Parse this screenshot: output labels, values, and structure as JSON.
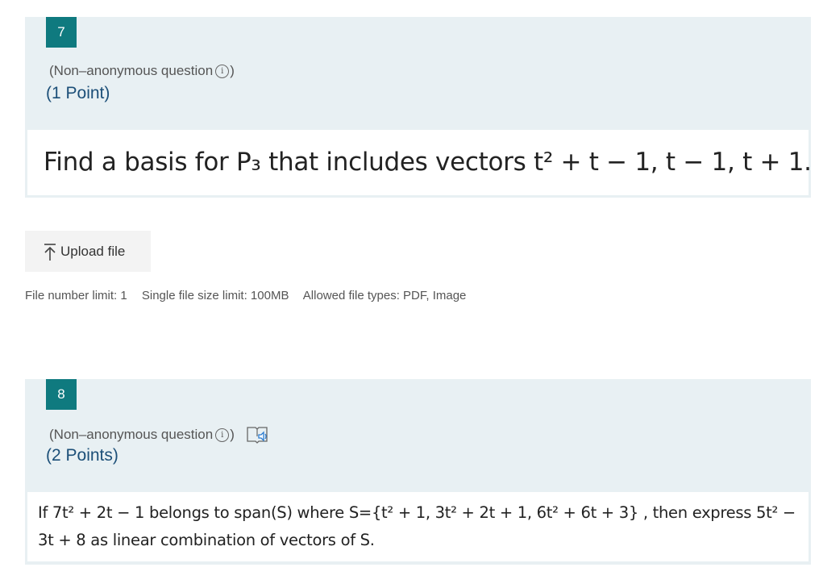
{
  "questions": [
    {
      "number": "7",
      "meta_label": "(Non–anonymous question",
      "meta_close": ")",
      "info_glyph": "i",
      "points": "(1 Point)",
      "body": "Find a basis for P₃ that includes vectors t² + t − 1, t − 1, t + 1."
    },
    {
      "number": "8",
      "meta_label": "(Non–anonymous question",
      "meta_close": ")",
      "info_glyph": "i",
      "points": "(2 Points)",
      "body": "If 7t² + 2t − 1 belongs to span(S) where S={t² + 1, 3t² + 2t + 1, 6t² + 6t + 3} , then express 5t² − 3t + 8 as linear combination of vectors of S."
    }
  ],
  "upload": {
    "label": "Upload file",
    "icon": "upload-arrow-icon"
  },
  "file_limits": {
    "number_limit": "File number limit: 1",
    "size_limit": "Single file size limit: 100MB",
    "types": "Allowed file types: PDF, Image"
  },
  "colors": {
    "accent": "#0f7a7f",
    "card_bg": "#e8f0f3",
    "points_text": "#1c4f78"
  }
}
